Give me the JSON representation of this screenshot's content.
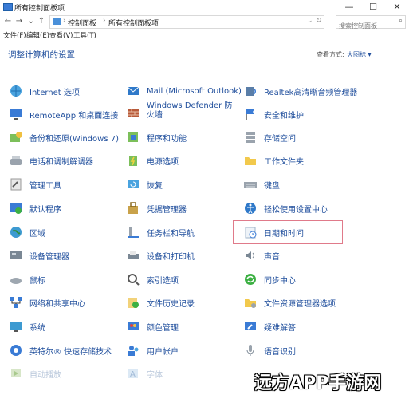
{
  "window": {
    "title": "所有控制面板项",
    "minimize": "—",
    "maximize": "☐",
    "close": "✕"
  },
  "address": {
    "crumbs": [
      "控制面板",
      "所有控制面板项"
    ],
    "search_placeholder": "搜索控制面板"
  },
  "menu": [
    "文件(F)",
    "编辑(E)",
    "查看(V)",
    "工具(T)"
  ],
  "main": {
    "heading": "调整计算机的设置",
    "view_by_label": "查看方式:",
    "view_by_value": "大图标 ▾"
  },
  "items": {
    "col1": [
      "Internet 选项",
      "RemoteApp 和桌面连接",
      "备份和还原(Windows 7)",
      "电话和调制解调器",
      "管理工具",
      "默认程序",
      "区域",
      "设备管理器",
      "鼠标",
      "网络和共享中心",
      "系统",
      "英特尔® 快速存储技术",
      "自动播放"
    ],
    "col2": [
      "Mail (Microsoft Outlook)",
      "Windows Defender 防火墙",
      "程序和功能",
      "电源选项",
      "恢复",
      "凭据管理器",
      "任务栏和导航",
      "设备和打印机",
      "索引选项",
      "文件历史记录",
      "颜色管理",
      "用户帐户",
      "字体"
    ],
    "col3": [
      "Realtek高清晰音频管理器",
      "安全和维护",
      "存储空间",
      "工作文件夹",
      "键盘",
      "轻松使用设置中心",
      "日期和时间",
      "声音",
      "同步中心",
      "文件资源管理器选项",
      "疑难解答",
      "语音识别"
    ]
  },
  "watermark": "远方APP手游网",
  "colors": {
    "link": "#1f4e9c",
    "highlight_border": "#e07a8a"
  }
}
